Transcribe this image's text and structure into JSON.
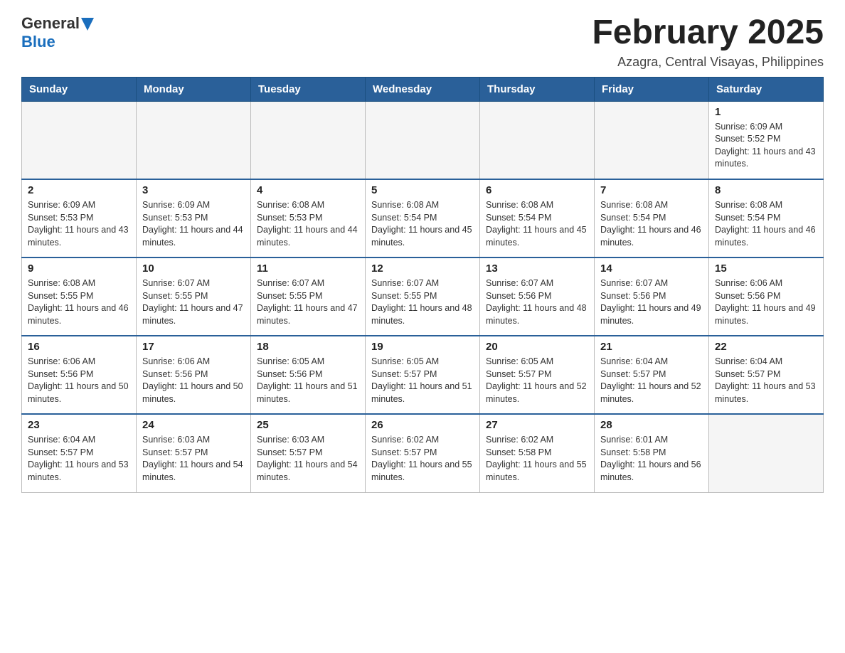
{
  "header": {
    "logo": {
      "text_general": "General",
      "text_blue": "Blue"
    },
    "title": "February 2025",
    "location": "Azagra, Central Visayas, Philippines"
  },
  "calendar": {
    "days_of_week": [
      "Sunday",
      "Monday",
      "Tuesday",
      "Wednesday",
      "Thursday",
      "Friday",
      "Saturday"
    ],
    "weeks": [
      [
        {
          "day": "",
          "info": ""
        },
        {
          "day": "",
          "info": ""
        },
        {
          "day": "",
          "info": ""
        },
        {
          "day": "",
          "info": ""
        },
        {
          "day": "",
          "info": ""
        },
        {
          "day": "",
          "info": ""
        },
        {
          "day": "1",
          "info": "Sunrise: 6:09 AM\nSunset: 5:52 PM\nDaylight: 11 hours and 43 minutes."
        }
      ],
      [
        {
          "day": "2",
          "info": "Sunrise: 6:09 AM\nSunset: 5:53 PM\nDaylight: 11 hours and 43 minutes."
        },
        {
          "day": "3",
          "info": "Sunrise: 6:09 AM\nSunset: 5:53 PM\nDaylight: 11 hours and 44 minutes."
        },
        {
          "day": "4",
          "info": "Sunrise: 6:08 AM\nSunset: 5:53 PM\nDaylight: 11 hours and 44 minutes."
        },
        {
          "day": "5",
          "info": "Sunrise: 6:08 AM\nSunset: 5:54 PM\nDaylight: 11 hours and 45 minutes."
        },
        {
          "day": "6",
          "info": "Sunrise: 6:08 AM\nSunset: 5:54 PM\nDaylight: 11 hours and 45 minutes."
        },
        {
          "day": "7",
          "info": "Sunrise: 6:08 AM\nSunset: 5:54 PM\nDaylight: 11 hours and 46 minutes."
        },
        {
          "day": "8",
          "info": "Sunrise: 6:08 AM\nSunset: 5:54 PM\nDaylight: 11 hours and 46 minutes."
        }
      ],
      [
        {
          "day": "9",
          "info": "Sunrise: 6:08 AM\nSunset: 5:55 PM\nDaylight: 11 hours and 46 minutes."
        },
        {
          "day": "10",
          "info": "Sunrise: 6:07 AM\nSunset: 5:55 PM\nDaylight: 11 hours and 47 minutes."
        },
        {
          "day": "11",
          "info": "Sunrise: 6:07 AM\nSunset: 5:55 PM\nDaylight: 11 hours and 47 minutes."
        },
        {
          "day": "12",
          "info": "Sunrise: 6:07 AM\nSunset: 5:55 PM\nDaylight: 11 hours and 48 minutes."
        },
        {
          "day": "13",
          "info": "Sunrise: 6:07 AM\nSunset: 5:56 PM\nDaylight: 11 hours and 48 minutes."
        },
        {
          "day": "14",
          "info": "Sunrise: 6:07 AM\nSunset: 5:56 PM\nDaylight: 11 hours and 49 minutes."
        },
        {
          "day": "15",
          "info": "Sunrise: 6:06 AM\nSunset: 5:56 PM\nDaylight: 11 hours and 49 minutes."
        }
      ],
      [
        {
          "day": "16",
          "info": "Sunrise: 6:06 AM\nSunset: 5:56 PM\nDaylight: 11 hours and 50 minutes."
        },
        {
          "day": "17",
          "info": "Sunrise: 6:06 AM\nSunset: 5:56 PM\nDaylight: 11 hours and 50 minutes."
        },
        {
          "day": "18",
          "info": "Sunrise: 6:05 AM\nSunset: 5:56 PM\nDaylight: 11 hours and 51 minutes."
        },
        {
          "day": "19",
          "info": "Sunrise: 6:05 AM\nSunset: 5:57 PM\nDaylight: 11 hours and 51 minutes."
        },
        {
          "day": "20",
          "info": "Sunrise: 6:05 AM\nSunset: 5:57 PM\nDaylight: 11 hours and 52 minutes."
        },
        {
          "day": "21",
          "info": "Sunrise: 6:04 AM\nSunset: 5:57 PM\nDaylight: 11 hours and 52 minutes."
        },
        {
          "day": "22",
          "info": "Sunrise: 6:04 AM\nSunset: 5:57 PM\nDaylight: 11 hours and 53 minutes."
        }
      ],
      [
        {
          "day": "23",
          "info": "Sunrise: 6:04 AM\nSunset: 5:57 PM\nDaylight: 11 hours and 53 minutes."
        },
        {
          "day": "24",
          "info": "Sunrise: 6:03 AM\nSunset: 5:57 PM\nDaylight: 11 hours and 54 minutes."
        },
        {
          "day": "25",
          "info": "Sunrise: 6:03 AM\nSunset: 5:57 PM\nDaylight: 11 hours and 54 minutes."
        },
        {
          "day": "26",
          "info": "Sunrise: 6:02 AM\nSunset: 5:57 PM\nDaylight: 11 hours and 55 minutes."
        },
        {
          "day": "27",
          "info": "Sunrise: 6:02 AM\nSunset: 5:58 PM\nDaylight: 11 hours and 55 minutes."
        },
        {
          "day": "28",
          "info": "Sunrise: 6:01 AM\nSunset: 5:58 PM\nDaylight: 11 hours and 56 minutes."
        },
        {
          "day": "",
          "info": ""
        }
      ]
    ]
  }
}
